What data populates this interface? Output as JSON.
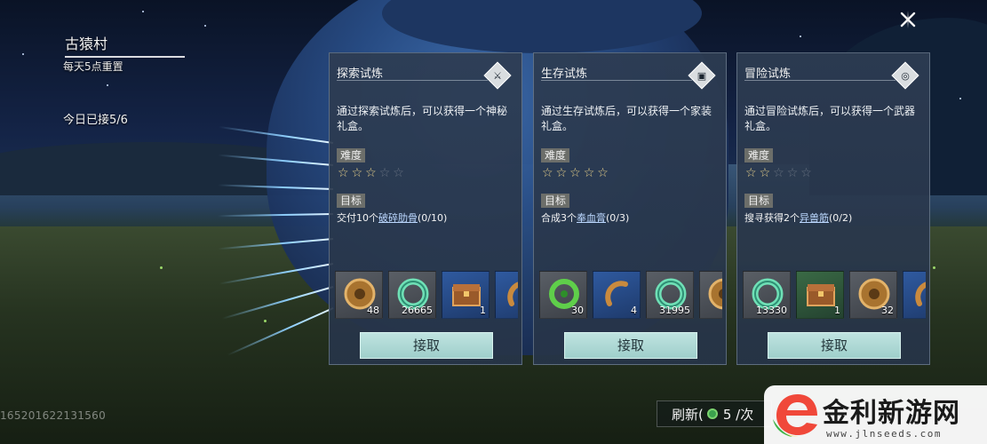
{
  "hud": {
    "village": "古猿村",
    "reset": "每天5点重置",
    "accepted": "今日已接5/6",
    "uid": "165201622131560",
    "close_icon": "close-x-icon"
  },
  "trials": [
    {
      "title": "探索试炼",
      "emblem_icon": "explore-emblem-icon",
      "desc": "通过探索试炼后，可以获得一个神秘礼盒。",
      "difficulty_label": "难度",
      "difficulty": 3,
      "goal_label": "目标",
      "goal_prefix": "交付10个",
      "goal_item": "破碎肋骨",
      "goal_progress": "(0/10)",
      "rewards": [
        {
          "icon": "bronze-coin-icon",
          "count": "48",
          "bg": "gray"
        },
        {
          "icon": "jade-ring-icon",
          "count": "26665",
          "bg": "gray"
        },
        {
          "icon": "treasure-chest-icon",
          "count": "1",
          "bg": "blue"
        },
        {
          "icon": "bronze-bracelet-icon",
          "count": "",
          "bg": "blue"
        }
      ],
      "accept": "接取"
    },
    {
      "title": "生存试炼",
      "emblem_icon": "survival-emblem-icon",
      "desc": "通过生存试炼后，可以获得一个家装礼盒。",
      "difficulty_label": "难度",
      "difficulty": 5,
      "goal_label": "目标",
      "goal_prefix": "合成3个",
      "goal_item": "奉血膏",
      "goal_progress": "(0/3)",
      "rewards": [
        {
          "icon": "green-coin-icon",
          "count": "30",
          "bg": "gray"
        },
        {
          "icon": "bronze-bracelet-icon",
          "count": "4",
          "bg": "blue"
        },
        {
          "icon": "jade-ring-icon",
          "count": "31995",
          "bg": "gray"
        },
        {
          "icon": "bronze-coin-icon",
          "count": "",
          "bg": "gray"
        }
      ],
      "accept": "接取"
    },
    {
      "title": "冒险试炼",
      "emblem_icon": "adventure-emblem-icon",
      "desc": "通过冒险试炼后，可以获得一个武器礼盒。",
      "difficulty_label": "难度",
      "difficulty": 2,
      "goal_label": "目标",
      "goal_prefix": "搜寻获得2个",
      "goal_item": "异兽筋",
      "goal_progress": "(0/2)",
      "rewards": [
        {
          "icon": "jade-ring-icon",
          "count": "13330",
          "bg": "gray"
        },
        {
          "icon": "treasure-chest-icon",
          "count": "1",
          "bg": "green"
        },
        {
          "icon": "bronze-coin-icon",
          "count": "32",
          "bg": "gray"
        },
        {
          "icon": "bronze-bracelet-icon",
          "count": "",
          "bg": "blue"
        }
      ],
      "accept": "接取"
    }
  ],
  "refresh": {
    "label": "刷新(",
    "icon": "green-coin-icon",
    "cost": "5 /次"
  },
  "watermark": {
    "text": "金利新游网",
    "url": "www.jlnseeds.com"
  },
  "colors": {
    "accept_button": "#aad8d4",
    "star_on": "#e9d28b",
    "card_bg": "#2d3c52",
    "link": "#bcd8ff"
  }
}
